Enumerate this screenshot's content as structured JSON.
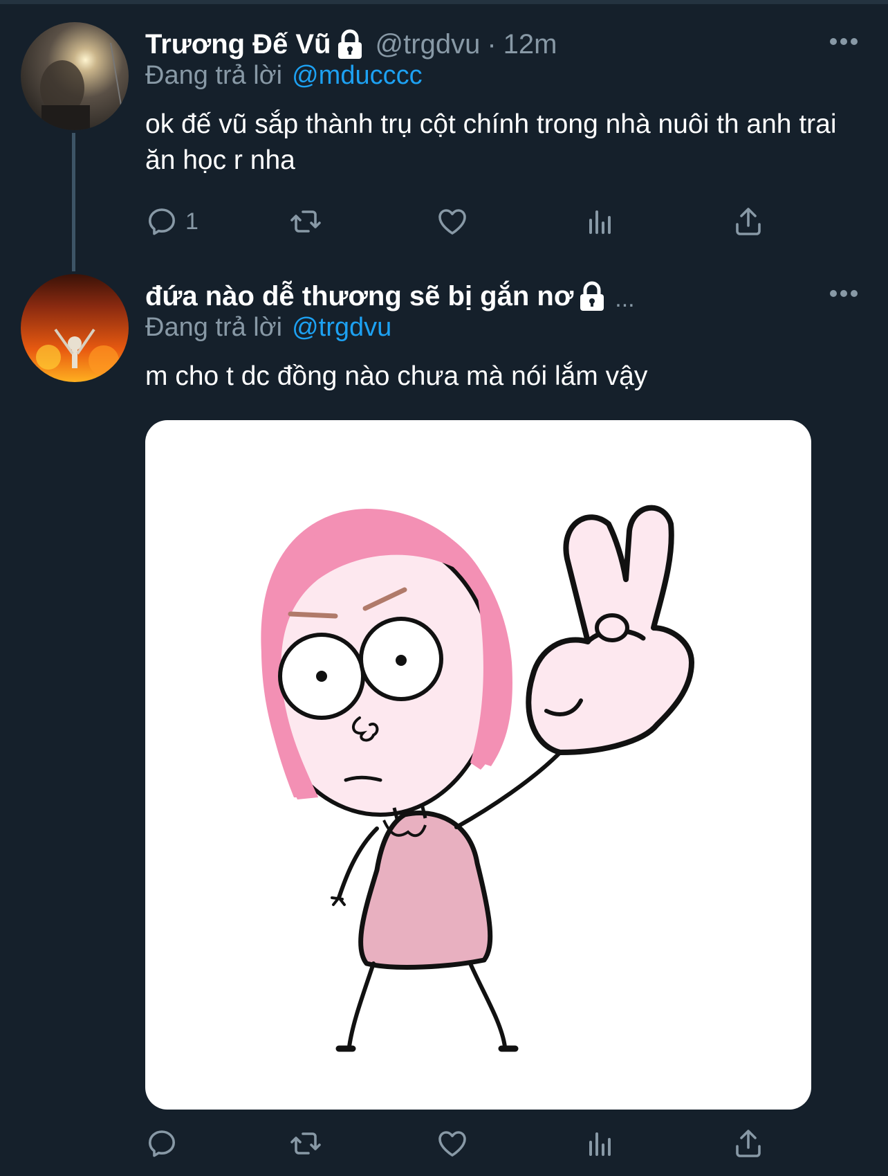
{
  "colors": {
    "background": "#15202b",
    "text": "#ffffff",
    "secondary": "#8899a6",
    "link": "#1da1f2",
    "thread_line": "#3d5466"
  },
  "tweet1": {
    "display_name": "Trương Đế Vũ",
    "handle": "@trgdvu",
    "separator": "·",
    "time": "12m",
    "protected_icon": "lock-icon",
    "reply_label": "Đang trả lời",
    "reply_to": "@mducccc",
    "text": "ok đế vũ sắp thành trụ cột chính trong nhà nuôi th anh trai ăn học r nha",
    "reply_count": "1",
    "actions": [
      "reply-icon",
      "retweet-icon",
      "like-icon",
      "analytics-icon",
      "share-icon"
    ]
  },
  "tweet2": {
    "display_name": "đứa nào dễ thương sẽ bị gắn nơ",
    "truncation": "...",
    "protected_icon": "lock-icon",
    "reply_label": "Đang trả lời",
    "reply_to": "@trgdvu",
    "text": "m cho t dc đồng nào chưa mà nói lắm vậy",
    "media_description_icon": "cartoon-girl-peace-sign-image",
    "actions": [
      "reply-icon",
      "retweet-icon",
      "like-icon",
      "analytics-icon",
      "share-icon"
    ]
  }
}
